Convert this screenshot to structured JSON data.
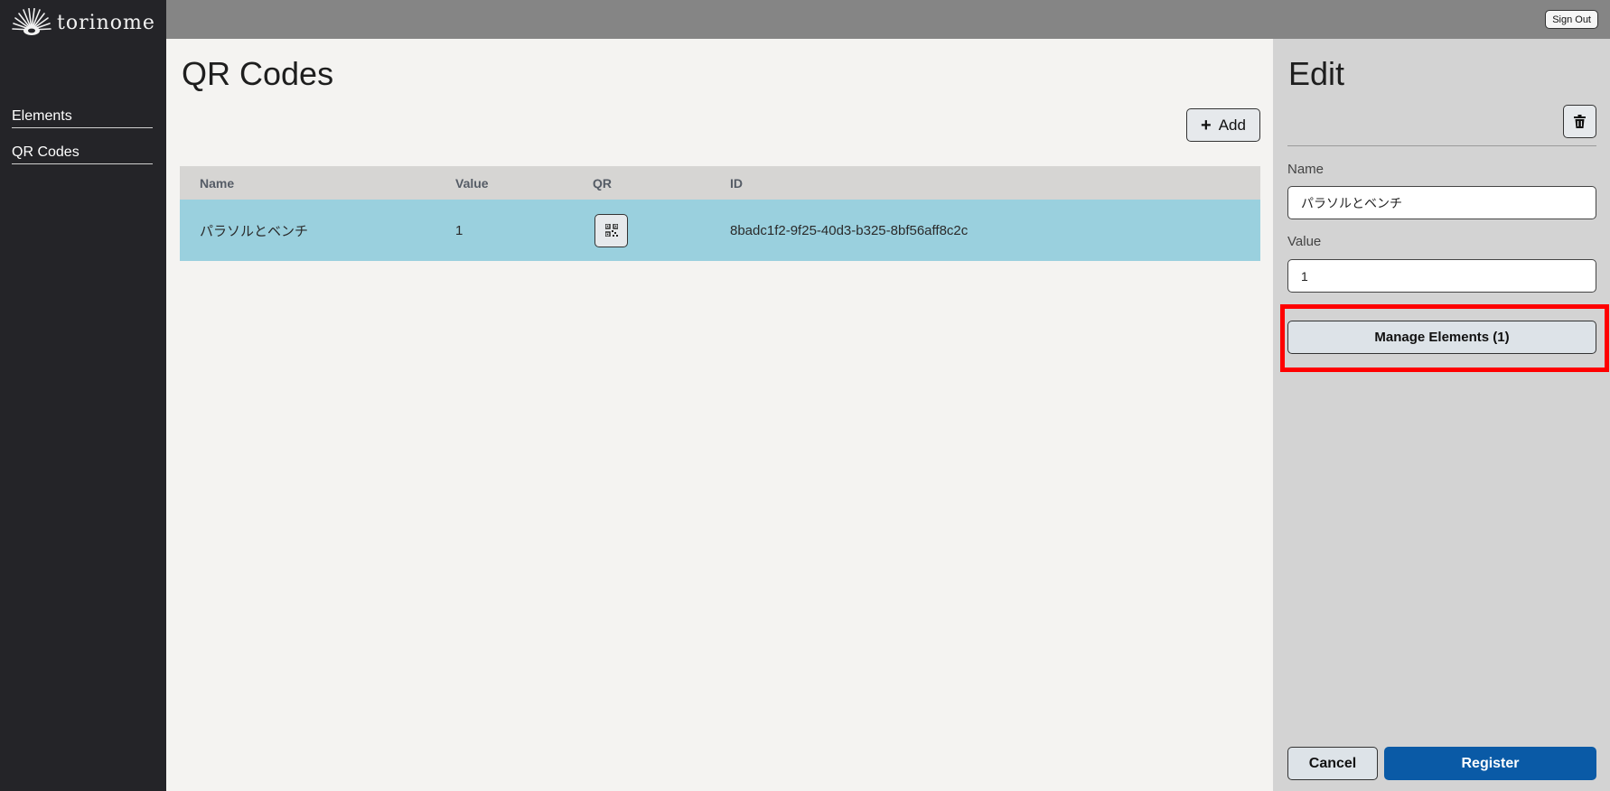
{
  "app": {
    "logo_text": "torinome"
  },
  "topbar": {
    "signout_label": "Sign Out"
  },
  "sidebar": {
    "items": [
      {
        "label": "Elements"
      },
      {
        "label": "QR Codes"
      }
    ]
  },
  "main": {
    "title": "QR Codes",
    "add_label": "Add",
    "table": {
      "headers": [
        "Name",
        "Value",
        "QR",
        "ID"
      ],
      "rows": [
        {
          "name": "パラソルとベンチ",
          "value": "1",
          "id": "8badc1f2-9f25-40d3-b325-8bf56aff8c2c"
        }
      ]
    }
  },
  "panel": {
    "title": "Edit",
    "name_label": "Name",
    "name_value": "パラソルとベンチ",
    "value_label": "Value",
    "value_value": "1",
    "manage_label": "Manage Elements (1)",
    "cancel_label": "Cancel",
    "register_label": "Register"
  },
  "colors": {
    "sidebar_bg": "#242428",
    "topbar_bg": "#858585",
    "selected_row": "#9ad0de",
    "primary": "#0a5aa6",
    "highlight": "#ff0000"
  },
  "icons": [
    "logo-icon",
    "plus-icon",
    "qr-icon",
    "trash-icon"
  ]
}
